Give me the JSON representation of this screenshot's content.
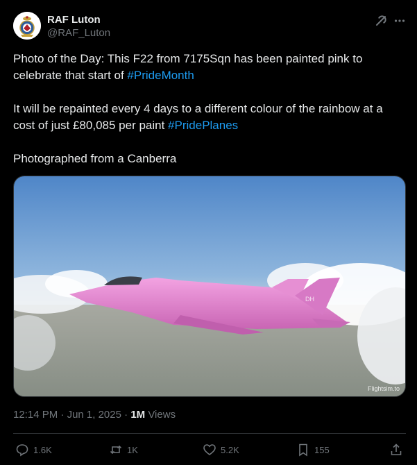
{
  "author": {
    "name": "RAF Luton",
    "handle": "@RAF_Luton",
    "avatar_icon": "raf-crest-icon"
  },
  "header_icons": [
    "grok-icon",
    "more-icon"
  ],
  "post": {
    "p1_text": "Photo of the Day: This F22 from 7175Sqn has been painted pink to celebrate that start of ",
    "p1_tag": "#PrideMonth",
    "p2_text": "It will be repainted every 4 days to a different colour of the rainbow at a cost of just £80,085 per paint ",
    "p2_tag": "#PridePlanes",
    "p3_text": "Photographed from a Canberra"
  },
  "media": {
    "description_icon": "pink-jet-photo",
    "watermark": "Flightsim.to"
  },
  "meta": {
    "time": "12:14 PM",
    "sep1": " · ",
    "date": "Jun 1, 2025",
    "sep2": " · ",
    "views_count": "1M",
    "views_label": " Views"
  },
  "actions": {
    "reply": "1.6K",
    "repost": "1K",
    "like": "5.2K",
    "bookmark": "155"
  },
  "colors": {
    "background": "#000000",
    "text": "#e7e9ea",
    "muted": "#71767b",
    "link": "#1d9bf0",
    "jet": "#e48ad0"
  }
}
